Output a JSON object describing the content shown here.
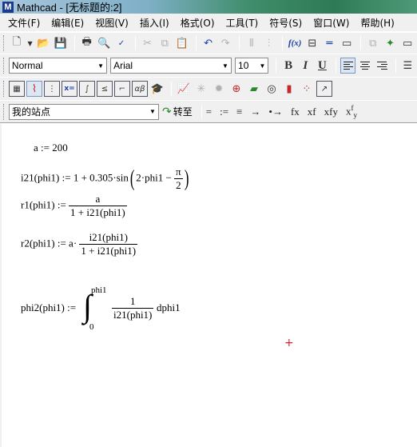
{
  "window": {
    "app_icon": "M",
    "title": "Mathcad - [无标题的:2]"
  },
  "menu": [
    "文件(F)",
    "编辑(E)",
    "视图(V)",
    "插入(I)",
    "格式(O)",
    "工具(T)",
    "符号(S)",
    "窗口(W)",
    "帮助(H)"
  ],
  "toolbar_standard": {
    "icons": [
      "new-document-icon",
      "dropdown-arrow-icon",
      "open-folder-icon",
      "save-icon",
      "print-icon",
      "print-preview-icon",
      "spell-check-icon",
      "cut-icon",
      "copy-icon",
      "paste-icon",
      "undo-icon",
      "redo-icon",
      "align-across-icon",
      "insert-function-icon",
      "insert-unit-icon",
      "calculate-icon",
      "region-icon",
      "resource-center-icon"
    ],
    "function_label": "f(x)"
  },
  "toolbar_format": {
    "style": "Normal",
    "font": "Arial",
    "size": "10",
    "bold": "B",
    "italic": "I",
    "underline": "U"
  },
  "toolbar_math": {
    "icons": [
      "calculator-icon",
      "graph-icon",
      "matrix-icon",
      "evaluation-icon",
      "calculus-icon",
      "boolean-icon",
      "programming-icon",
      "greek-icon",
      "symbolic-icon",
      "xy-plot-icon",
      "polar-plot-icon",
      "surface-plot-icon",
      "contour-plot-icon",
      "3d-bar-icon",
      "scatter-icon",
      "vector-field-icon"
    ],
    "eval_label": "x=",
    "greek_label": "αβ"
  },
  "toolbar_nav": {
    "location": "我的站点",
    "goto_label": "转至",
    "tools": [
      "=",
      ":=",
      "≡",
      "→",
      "•→",
      "fx",
      "xf",
      "xfy",
      "x"
    ],
    "tool_last_sup": "f",
    "tool_last_sub": "y"
  },
  "worksheet": {
    "a_def": "a := 200",
    "i21_lhs": "i21(phi1) := 1 + 0.305·sin",
    "i21_inner": "2·phi1 −",
    "pi": "π",
    "two": "2",
    "r1_lhs": "r1(phi1) :=",
    "r1_num": "a",
    "r1_den": "1 + i21(phi1)",
    "r2_lhs": "r2(phi1) := a·",
    "r2_num": "i21(phi1)",
    "r2_den": "1 + i21(phi1)",
    "phi2_lhs": "phi2(phi1) :=",
    "int_upper": "phi1",
    "int_lower": "0",
    "phi2_num": "1",
    "phi2_den": "i21(phi1)",
    "phi2_d": "dphi1",
    "cursor": "+"
  }
}
